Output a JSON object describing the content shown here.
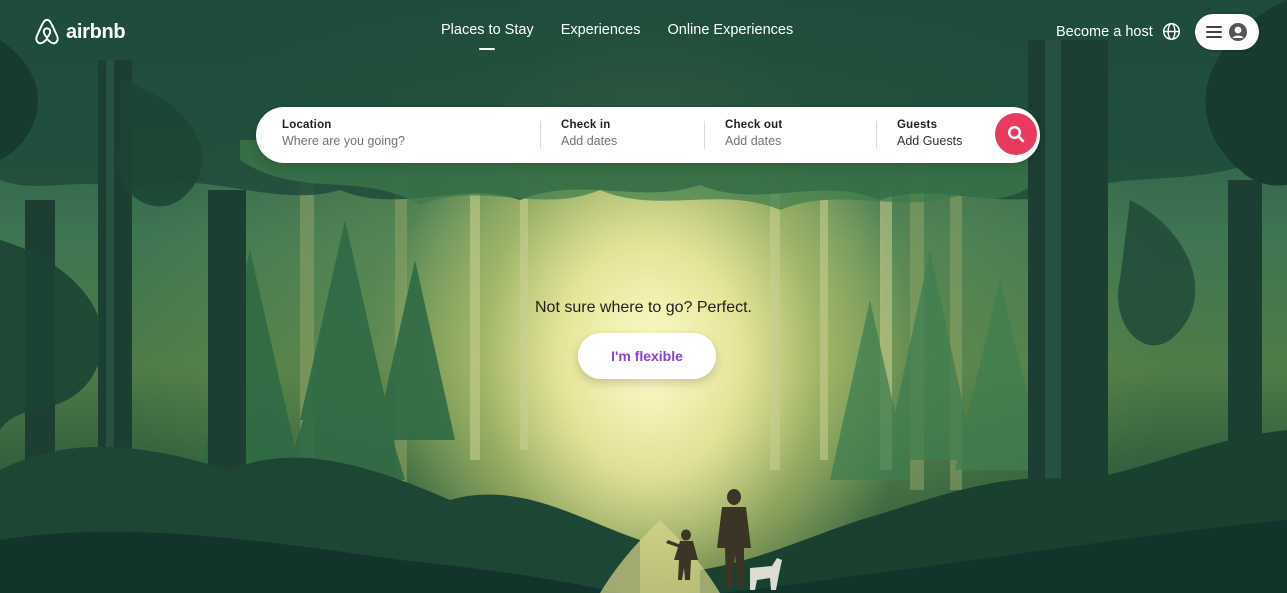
{
  "brand": {
    "name": "airbnb",
    "accent_color": "#ea3a5f",
    "logo_icon": "airbnb-belo-icon"
  },
  "nav": {
    "items": [
      {
        "label": "Places to Stay",
        "active": true
      },
      {
        "label": "Experiences",
        "active": false
      },
      {
        "label": "Online Experiences",
        "active": false
      }
    ]
  },
  "header_right": {
    "host_label": "Become a host",
    "language_icon": "globe-icon",
    "menu_icon": "hamburger-icon",
    "profile_icon": "user-avatar-icon"
  },
  "search": {
    "location": {
      "label": "Location",
      "placeholder": "Where are you going?"
    },
    "check_in": {
      "label": "Check in",
      "value": "Add dates"
    },
    "check_out": {
      "label": "Check out",
      "value": "Add dates"
    },
    "guests": {
      "label": "Guests",
      "value": "Add Guests"
    },
    "button_icon": "search-icon"
  },
  "hero": {
    "prompt": "Not sure where to go? Perfect.",
    "cta_label": "I'm flexible",
    "cta_color": "#8a43c9"
  }
}
